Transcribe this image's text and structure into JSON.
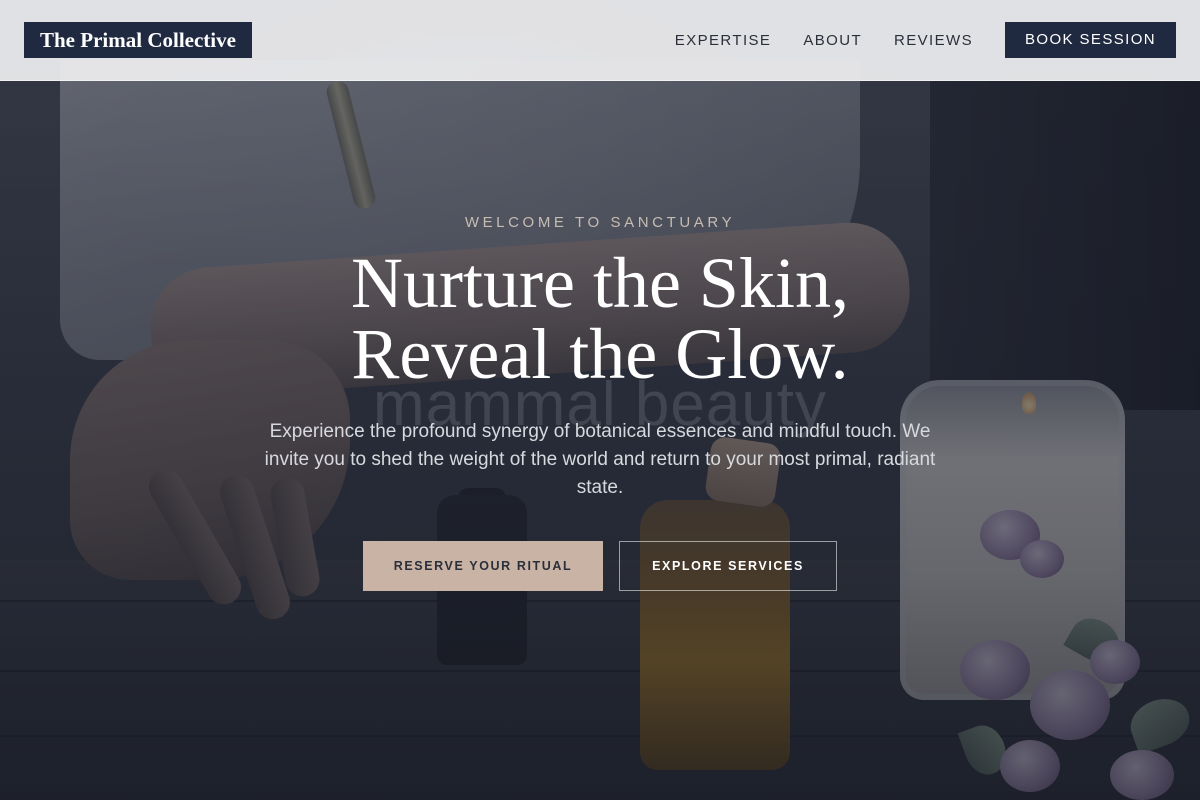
{
  "header": {
    "logo": "The Primal Collective",
    "nav": [
      {
        "label": "EXPERTISE"
      },
      {
        "label": "ABOUT"
      },
      {
        "label": "REVIEWS"
      }
    ],
    "book_button": "BOOK SESSION"
  },
  "hero": {
    "eyebrow": "WELCOME TO SANCTUARY",
    "headline_line1": "Nurture the Skin,",
    "headline_line2": "Reveal the Glow.",
    "ghost_word": "mammal beauty",
    "lead": "Experience the profound synergy of botanical essences and mindful touch. We invite you to shed the weight of the world and return to your most primal, radiant state.",
    "primary_cta": "RESERVE YOUR RITUAL",
    "secondary_cta": "EXPLORE SERVICES"
  },
  "colors": {
    "brand_navy": "#1f2a40",
    "accent_sand": "#c9b3a5",
    "header_bg": "#eeeef0"
  }
}
